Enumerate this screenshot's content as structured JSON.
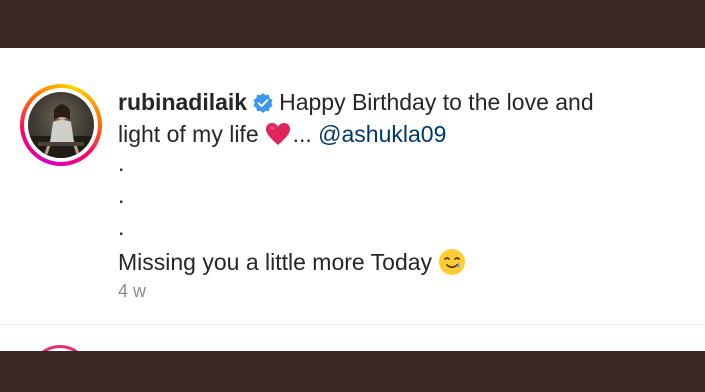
{
  "post": {
    "username": "rubinadilaik",
    "caption_line1": "Happy Birthday to the love and",
    "caption_line2_prefix": "light of my life",
    "ellipsis": "...",
    "mention": "@ashukla09",
    "dots": [
      ".",
      ".",
      "."
    ],
    "caption_last": "Missing you a little more Today",
    "timestamp": "4 w"
  },
  "icons": {
    "verified": "verified-badge-icon",
    "heart": "red-heart-emoji",
    "smile_tear": "smiling-face-with-tear-emoji"
  },
  "colors": {
    "frame": "#3a2624",
    "text": "#262626",
    "mention": "#00376b",
    "timestamp": "#8e8e8e",
    "verified": "#3897f0",
    "heart": "#e0245e"
  }
}
